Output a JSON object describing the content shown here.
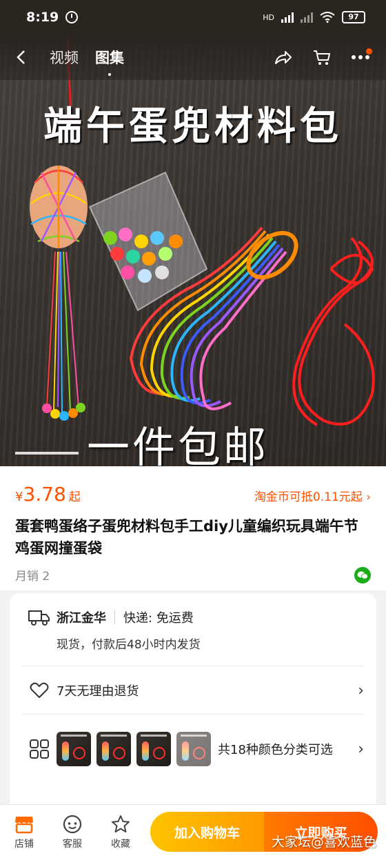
{
  "status_bar": {
    "time": "8:19",
    "network": "HD",
    "battery": "97"
  },
  "nav": {
    "tabs": [
      {
        "label": "视频"
      },
      {
        "label": "图集"
      }
    ],
    "active_tab": "图集"
  },
  "hero": {
    "title": "端午蛋兜材料包",
    "subtitle": "一件包邮"
  },
  "product": {
    "price_symbol": "¥",
    "price": "3.78",
    "price_suffix": "起",
    "coupon": "淘金币可抵0.11元起",
    "title": "蛋套鸭蛋络子蛋兜材料包手工diy儿童编织玩具端午节鸡蛋网撞蛋袋",
    "sales": "月销 2"
  },
  "service": {
    "ship_from": "浙江金华",
    "delivery": "快递: 免运费",
    "dispatch": "现货，付款后48小时内发货",
    "returns": "7天无理由退货",
    "colors_text": "共18种颜色分类可选"
  },
  "bottom_bar": {
    "shop": "店铺",
    "service": "客服",
    "favorite": "收藏",
    "add_to_cart": "加入购物车",
    "buy_now": "立即购买"
  },
  "watermark": "大家坛@喜欢蓝色",
  "colors": {
    "accent": "#ff5000",
    "cart_gradient": "#ffc400",
    "buy_gradient": "#ff4e00",
    "wechat": "#1aad19"
  },
  "icons": [
    "back-icon",
    "share-icon",
    "cart-icon",
    "more-icon",
    "wechat-icon",
    "truck-icon",
    "heart-icon",
    "sku-grid-icon",
    "shop-icon",
    "service-icon",
    "star-icon"
  ]
}
